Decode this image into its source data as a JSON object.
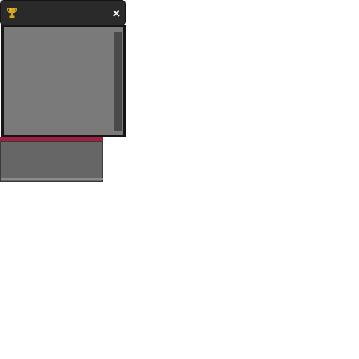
{
  "window": {
    "title_icon": "trophy-icon",
    "close_label": "×",
    "colors": {
      "titlebar": "#2a2a2a",
      "content": "#7a7a7a",
      "scrollbar": "#4a4a4a",
      "accent": "#a0213f",
      "footer": "#666666",
      "trophy": "#d4a017"
    }
  }
}
